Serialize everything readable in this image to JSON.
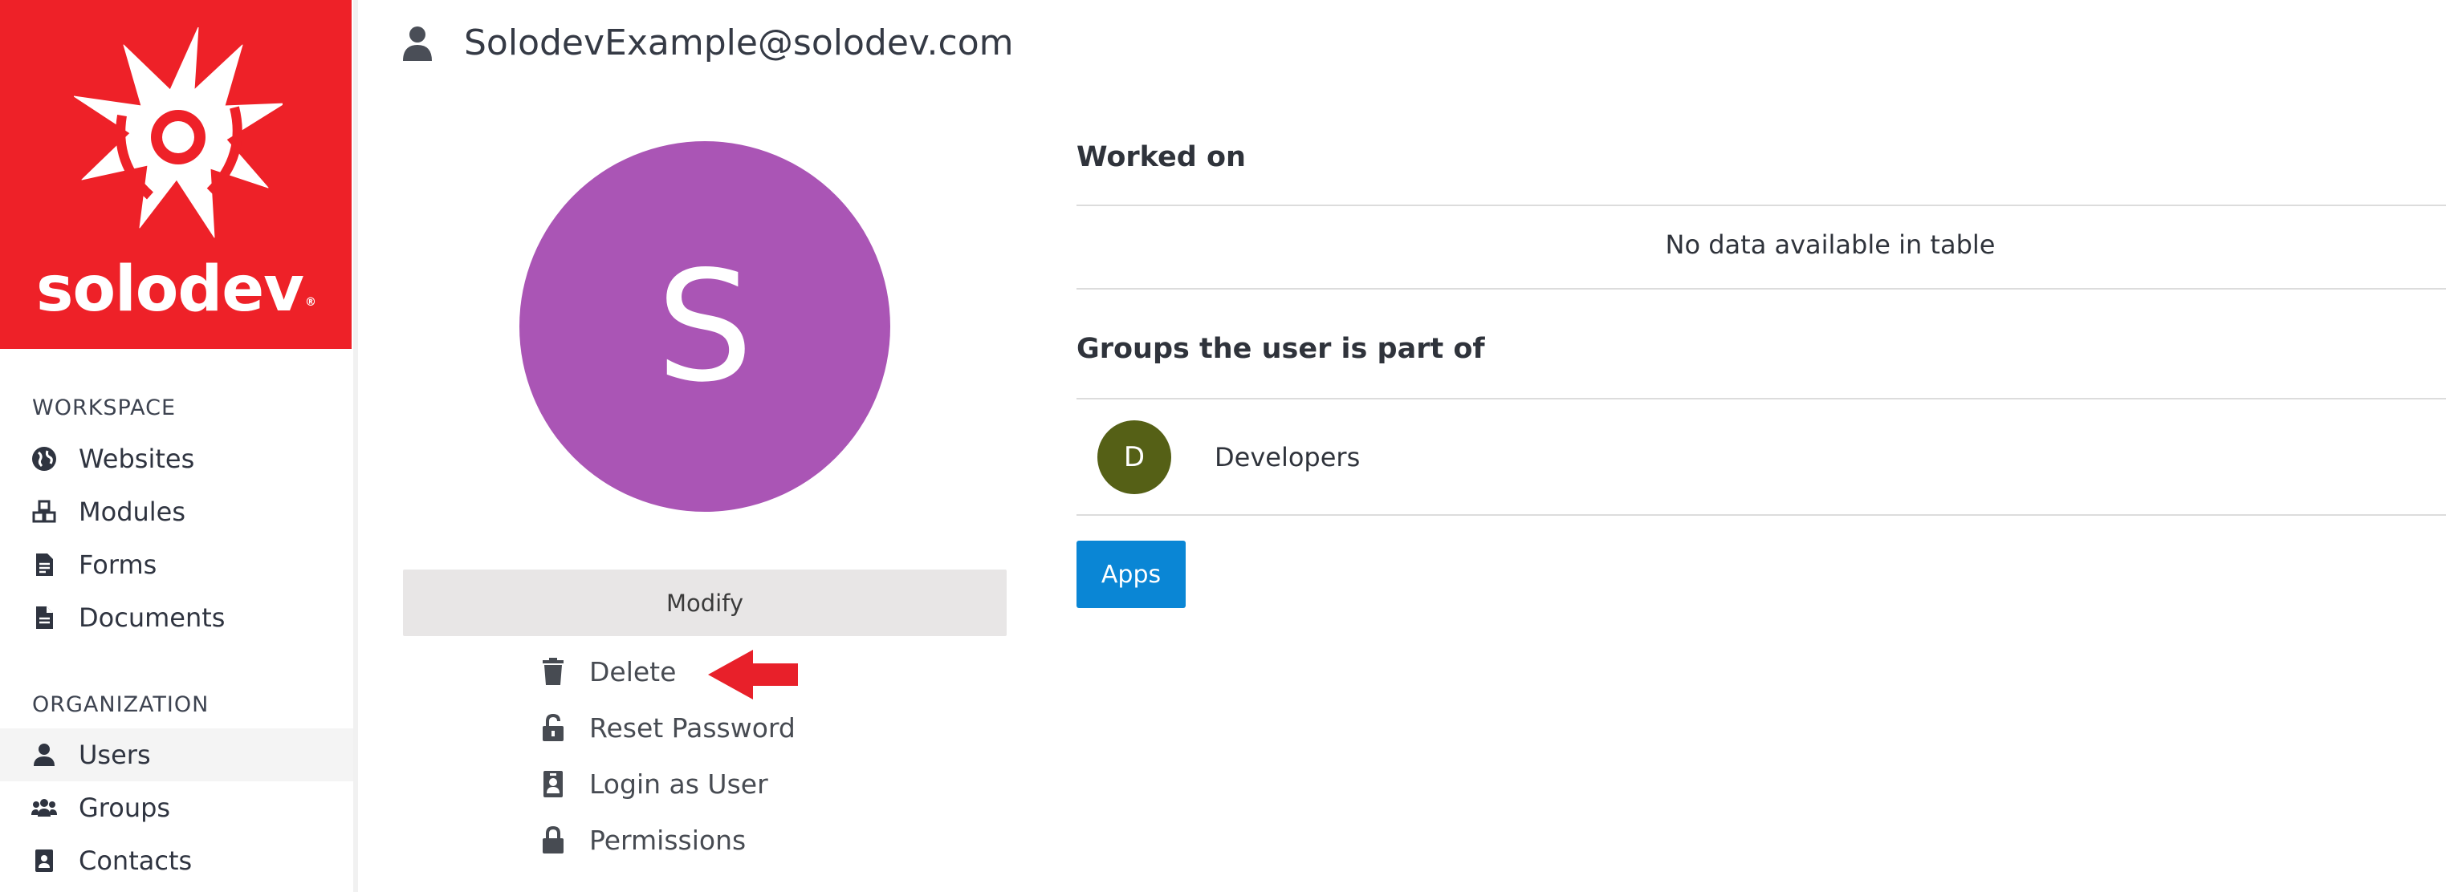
{
  "brand": {
    "name": "solodev",
    "trademark": "®",
    "color": "#ee2128"
  },
  "sidebar": {
    "sections": [
      {
        "title": "WORKSPACE",
        "items": [
          {
            "label": "Websites",
            "icon": "globe-icon"
          },
          {
            "label": "Modules",
            "icon": "cubes-icon"
          },
          {
            "label": "Forms",
            "icon": "form-icon"
          },
          {
            "label": "Documents",
            "icon": "document-icon"
          }
        ]
      },
      {
        "title": "ORGANIZATION",
        "items": [
          {
            "label": "Users",
            "icon": "user-icon",
            "active": true
          },
          {
            "label": "Groups",
            "icon": "users-icon"
          },
          {
            "label": "Contacts",
            "icon": "contact-card-icon"
          }
        ]
      }
    ]
  },
  "header": {
    "email": "SolodevExample@solodev.com",
    "icon": "user-icon"
  },
  "profile": {
    "initial": "S",
    "avatar_color": "#aa55b5",
    "modify_label": "Modify",
    "actions": [
      {
        "label": "Delete",
        "icon": "trash-icon",
        "highlighted": true
      },
      {
        "label": "Reset Password",
        "icon": "unlock-icon"
      },
      {
        "label": "Login as User",
        "icon": "id-badge-icon"
      },
      {
        "label": "Permissions",
        "icon": "lock-icon"
      }
    ]
  },
  "worked_on": {
    "heading": "Worked on",
    "empty_text": "No data available in table"
  },
  "groups": {
    "heading": "Groups the user is part of",
    "items": [
      {
        "initial": "D",
        "name": "Developers",
        "color": "#556016"
      }
    ]
  },
  "apps_button": {
    "label": "Apps",
    "color": "#0a86d5"
  }
}
